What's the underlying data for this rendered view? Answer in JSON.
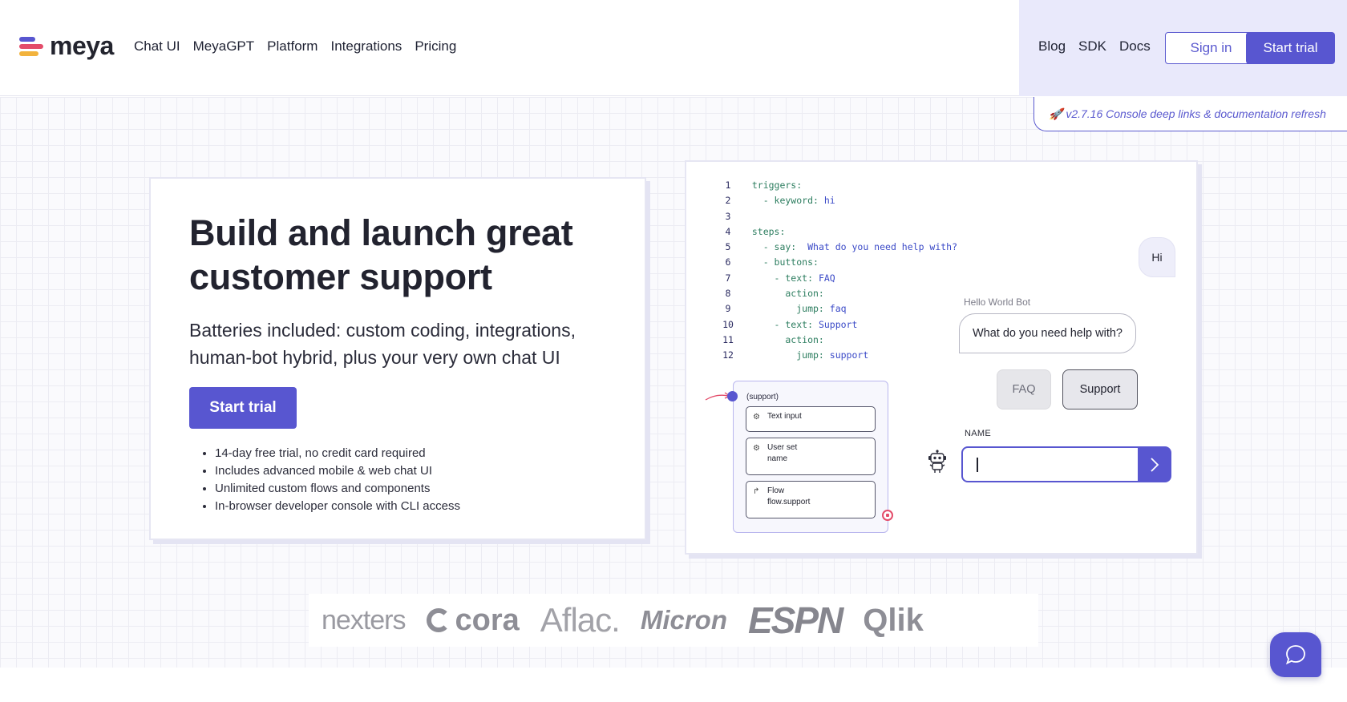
{
  "header": {
    "logo_text": "meya",
    "logo_colors": [
      "#5856d0",
      "#e34c6a",
      "#f2b33d"
    ],
    "nav_left": [
      "Chat UI",
      "MeyaGPT",
      "Platform",
      "Integrations",
      "Pricing"
    ],
    "nav_right": [
      "Blog",
      "SDK",
      "Docs"
    ],
    "signin_label": "Sign in",
    "trial_label": "Start trial"
  },
  "release_note": "🚀 v2.7.16 Console deep links & documentation refresh",
  "hero": {
    "title": "Build and launch great customer support",
    "subtitle": "Batteries included: custom coding, integrations, human-bot hybrid, plus your very own chat UI",
    "cta_label": "Start trial",
    "bullets": [
      "14-day free trial, no credit card required",
      "Includes advanced mobile & web chat UI",
      "Unlimited custom flows and components",
      "In-browser developer console with CLI access"
    ]
  },
  "demo": {
    "code_lines": [
      {
        "n": "1",
        "indent": "",
        "key": "triggers:",
        "val": ""
      },
      {
        "n": "2",
        "indent": "  ",
        "key": "- keyword:",
        "val": " hi"
      },
      {
        "n": "3",
        "indent": "",
        "key": "",
        "val": ""
      },
      {
        "n": "4",
        "indent": "",
        "key": "steps:",
        "val": ""
      },
      {
        "n": "5",
        "indent": "  ",
        "key": "- say:",
        "val": "  What do you need help with?"
      },
      {
        "n": "6",
        "indent": "  ",
        "key": "- buttons:",
        "val": ""
      },
      {
        "n": "7",
        "indent": "    ",
        "key": "- text:",
        "val": " FAQ"
      },
      {
        "n": "8",
        "indent": "      ",
        "key": "action:",
        "val": ""
      },
      {
        "n": "9",
        "indent": "        ",
        "key": "jump:",
        "val": " faq"
      },
      {
        "n": "10",
        "indent": "    ",
        "key": "- text:",
        "val": " Support"
      },
      {
        "n": "11",
        "indent": "      ",
        "key": "action:",
        "val": ""
      },
      {
        "n": "12",
        "indent": "        ",
        "key": "jump:",
        "val": " support"
      }
    ],
    "flow": {
      "title": "(support)",
      "nodes": [
        {
          "label": "Text input",
          "sub": ""
        },
        {
          "label": "User set",
          "sub": "name"
        },
        {
          "label": "Flow",
          "sub": "flow.support"
        }
      ]
    },
    "chat": {
      "user_message": "Hi",
      "bot_name": "Hello World Bot",
      "bot_message": "What do you need help with?",
      "buttons": [
        "FAQ",
        "Support"
      ],
      "field_label": "NAME",
      "input_value": ""
    }
  },
  "logos": [
    "nexters",
    "cora",
    "Aflac.",
    "Micron",
    "ESPN",
    "Qlik"
  ]
}
